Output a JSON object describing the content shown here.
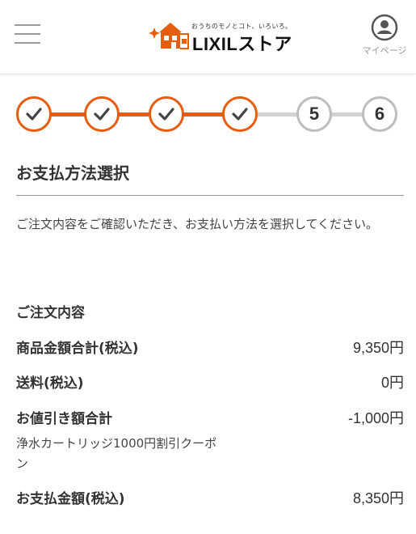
{
  "header": {
    "menu_icon": "hamburger-menu-icon",
    "logo": {
      "icon": "lixil-house-sparkle-logo",
      "tagline": "おうちのモノとコト、いろいろ。",
      "name": "LIXILストア",
      "accent_color": "#e65d0d"
    },
    "mypage": {
      "icon": "user-circle-icon",
      "label": "マイページ"
    }
  },
  "stepper": {
    "active_color": "#e65d0d",
    "inactive_color": "#bdbdbd",
    "steps": [
      {
        "label": "",
        "status": "done",
        "icon": "check-icon"
      },
      {
        "label": "",
        "status": "done",
        "icon": "check-icon"
      },
      {
        "label": "",
        "status": "done",
        "icon": "check-icon"
      },
      {
        "label": "",
        "status": "done",
        "icon": "check-icon"
      },
      {
        "label": "5",
        "status": "todo"
      },
      {
        "label": "6",
        "status": "todo"
      }
    ]
  },
  "page": {
    "title": "お支払方法選択",
    "intro": "ご注文内容をご確認いただき、お支払い方法を選択してください。"
  },
  "order_summary": {
    "title": "ご注文内容",
    "subtotal": {
      "label": "商品金額合計(税込)",
      "value": "9,350円"
    },
    "shipping": {
      "label": "送料(税込)",
      "value": "0円"
    },
    "discount": {
      "label": "お値引き額合計",
      "value": "-1,000円",
      "detail": "浄水カートリッジ1000円割引クーポン"
    },
    "total": {
      "label": "お支払金額(税込)",
      "value": "8,350円"
    }
  }
}
